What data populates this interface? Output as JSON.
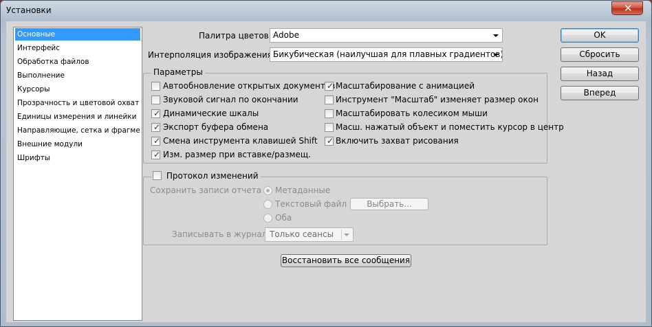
{
  "window": {
    "title": "Установки",
    "close_glyph": "✕"
  },
  "sidebar": {
    "items": [
      "Основные",
      "Интерфейс",
      "Обработка файлов",
      "Выполнение",
      "Курсоры",
      "Прозрачность и цветовой охват",
      "Единицы измерения и линейки",
      "Направляющие, сетка и фрагменты",
      "Внешние модули",
      "Шрифты"
    ],
    "selected": "Основные"
  },
  "main": {
    "palette_label": "Палитра цветов:",
    "palette_value": "Adobe",
    "interp_label": "Интерполяция изображения:",
    "interp_value": "Бикубическая (наилучшая для плавных градиентов)",
    "params": {
      "legend": "Параметры",
      "left": [
        {
          "label": "Автообновление открытых документов",
          "checked": false
        },
        {
          "label": "Звуковой сигнал по окончании",
          "checked": false
        },
        {
          "label": "Динамические шкалы",
          "checked": true
        },
        {
          "label": "Экспорт буфера обмена",
          "checked": true
        },
        {
          "label": "Смена инструмента клавишей Shift",
          "checked": true
        },
        {
          "label": "Изм. размер при вставке/размещ.",
          "checked": true
        }
      ],
      "right": [
        {
          "label": "Масштабирование с анимацией",
          "checked": true
        },
        {
          "label": "Инструмент \"Масштаб\" изменяет размер окон",
          "checked": false
        },
        {
          "label": "Масштабировать колесиком мыши",
          "checked": false
        },
        {
          "label": "Масш. нажатый объект и поместить курсор в центр",
          "checked": false
        },
        {
          "label": "Включить захват рисования",
          "checked": true
        }
      ]
    },
    "history": {
      "legend": "Протокол изменений",
      "checked": false,
      "save_label": "Сохранить записи отчета в:",
      "radio_metadata": "Метаданные",
      "radio_textfile": "Текстовый файл",
      "radio_both": "Оба",
      "choose_button": "Выбрать...",
      "journal_label": "Записывать в журнал:",
      "journal_value": "Только сеансы"
    },
    "restore_button": "Восстановить все сообщения"
  },
  "buttons": {
    "ok": "OK",
    "reset": "Сбросить",
    "back": "Назад",
    "forward": "Вперед"
  },
  "colors": {
    "selection": "#3399ff",
    "client_bg": "#d6d6d6",
    "close_button": "#cf4b34"
  }
}
